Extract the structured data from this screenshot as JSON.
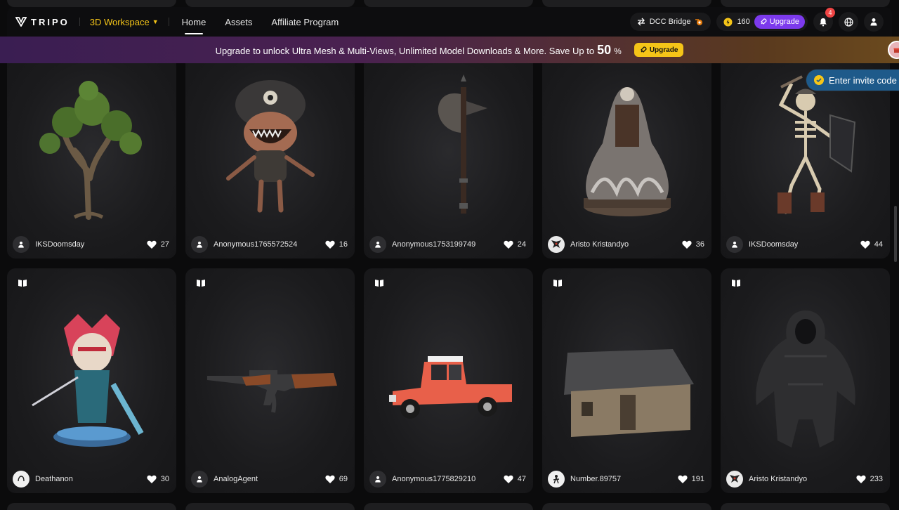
{
  "header": {
    "brand": "TRIPO",
    "workspace": "3D Workspace",
    "nav": [
      {
        "label": "Home",
        "active": true
      },
      {
        "label": "Assets",
        "active": false
      },
      {
        "label": "Affiliate Program",
        "active": false
      }
    ],
    "dcc_bridge": "DCC Bridge",
    "credits": "160",
    "upgrade": "Upgrade",
    "notification_count": "4"
  },
  "banner": {
    "text": "Upgrade to unlock Ultra Mesh & Multi-Views, Unlimited Model Downloads & More. Save Up to",
    "big": "50",
    "pct": "%",
    "button": "Upgrade"
  },
  "invite": "Enter invite code",
  "colors": {
    "accent_yellow": "#f5c518",
    "accent_purple": "#7c3aed",
    "badge_red": "#ef4444",
    "invite_blue": "#1e5a8a"
  },
  "cards": [
    {
      "user": "IKSDoomsday",
      "likes": "27",
      "model": "tree"
    },
    {
      "user": "Anonymous1765572524",
      "likes": "16",
      "model": "monster"
    },
    {
      "user": "Anonymous1753199749",
      "likes": "24",
      "model": "axe"
    },
    {
      "user": "Aristo Kristandyo",
      "likes": "36",
      "model": "ghost"
    },
    {
      "user": "IKSDoomsday",
      "likes": "44",
      "model": "skeleton"
    },
    {
      "user": "Deathanon",
      "likes": "30",
      "model": "warrior"
    },
    {
      "user": "AnalogAgent",
      "likes": "69",
      "model": "rifle"
    },
    {
      "user": "Anonymous1775829210",
      "likes": "47",
      "model": "truck"
    },
    {
      "user": "Number.89757",
      "likes": "191",
      "model": "hut"
    },
    {
      "user": "Aristo Kristandyo",
      "likes": "233",
      "model": "reaper"
    }
  ]
}
